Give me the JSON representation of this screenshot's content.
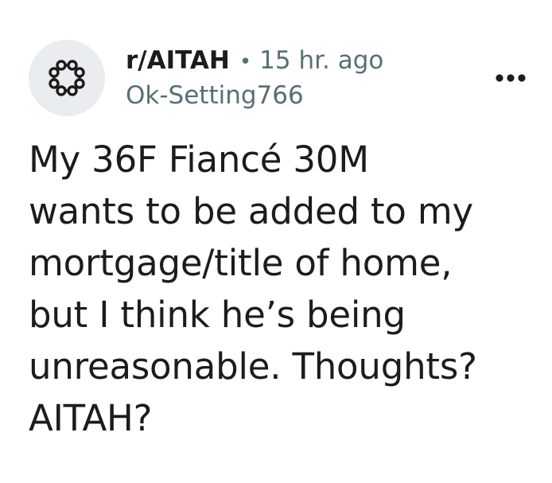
{
  "post": {
    "subreddit": "r/AITAH",
    "separator": "•",
    "time_ago": "15 hr. ago",
    "username": "Ok-Setting766",
    "more_icon": "ellipsis-horizontal-icon",
    "avatar_icon": "subreddit-community-icon",
    "title_lines": [
      "My 36F Fiancé 30M",
      "wants to be added to my",
      "mortgage/title of home,",
      "but I think he’s being",
      "unreasonable. Thoughts?",
      "AITAH?"
    ]
  },
  "colors": {
    "text_primary": "#1c1c1c",
    "text_secondary": "#576f76",
    "avatar_bg": "#eaedef"
  }
}
